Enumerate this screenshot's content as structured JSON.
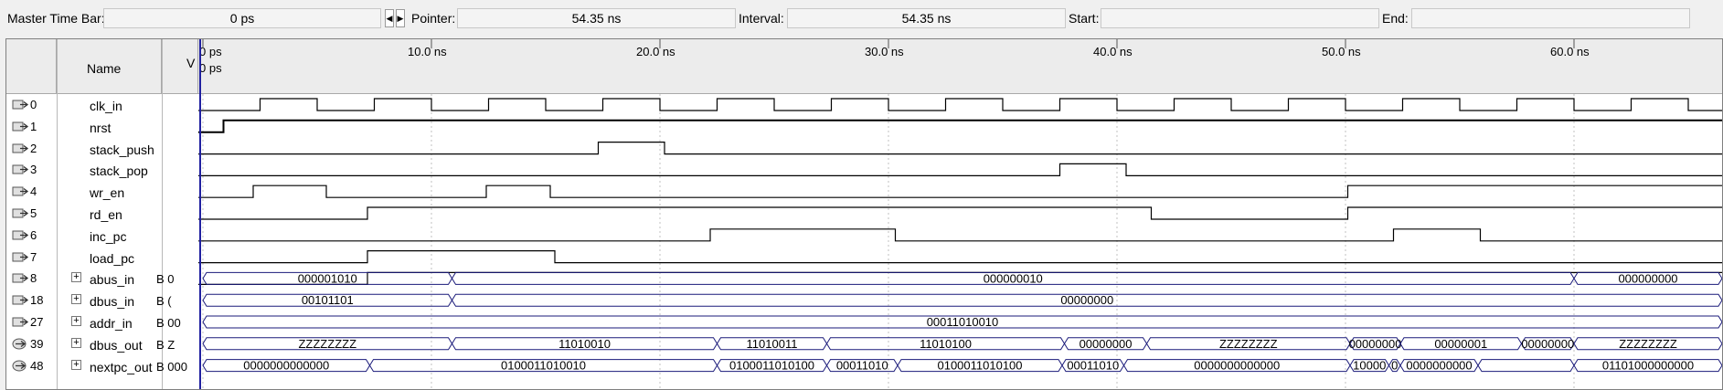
{
  "toolbar": {
    "master_label": "Master Time Bar:",
    "master_value": "0 ps",
    "pointer_label": "Pointer:",
    "pointer_value": "54.35 ns",
    "interval_label": "Interval:",
    "interval_value": "54.35 ns",
    "start_label": "Start:",
    "start_value": "",
    "end_label": "End:",
    "end_value": ""
  },
  "header": {
    "name": "Name",
    "value": "V"
  },
  "ruler": {
    "ticks": [
      "0 ps",
      "10.0 ns",
      "20.0 ns",
      "30.0 ns",
      "40.0 ns",
      "50.0 ns",
      "60.0 ns"
    ],
    "marker_label": "0 ps"
  },
  "signals": [
    {
      "index": "0",
      "name": "clk_in",
      "value": "",
      "kind": "in",
      "bus": false
    },
    {
      "index": "1",
      "name": "nrst",
      "value": "",
      "kind": "in",
      "bus": false
    },
    {
      "index": "2",
      "name": "stack_push",
      "value": "",
      "kind": "in",
      "bus": false
    },
    {
      "index": "3",
      "name": "stack_pop",
      "value": "",
      "kind": "in",
      "bus": false
    },
    {
      "index": "4",
      "name": "wr_en",
      "value": "",
      "kind": "in",
      "bus": false
    },
    {
      "index": "5",
      "name": "rd_en",
      "value": "",
      "kind": "in",
      "bus": false
    },
    {
      "index": "6",
      "name": "inc_pc",
      "value": "",
      "kind": "in",
      "bus": false
    },
    {
      "index": "7",
      "name": "load_pc",
      "value": "",
      "kind": "in",
      "bus": false
    },
    {
      "index": "8",
      "name": "abus_in",
      "value": "B 0",
      "kind": "in",
      "bus": true
    },
    {
      "index": "18",
      "name": "dbus_in",
      "value": "B (",
      "kind": "in",
      "bus": true
    },
    {
      "index": "27",
      "name": "addr_in",
      "value": "B 00",
      "kind": "in",
      "bus": true
    },
    {
      "index": "39",
      "name": "dbus_out",
      "value": "B Z",
      "kind": "out",
      "bus": true
    },
    {
      "index": "48",
      "name": "nextpc_out",
      "value": "B 000",
      "kind": "out",
      "bus": true
    }
  ],
  "waves": {
    "digital": [
      {
        "row": 0,
        "clock": true,
        "period_ns": 5,
        "first_high_ns": 2.5
      },
      {
        "row": 1,
        "init": 0,
        "edges": [
          0.9
        ]
      },
      {
        "row": 2,
        "init": 0,
        "edges": [
          17.3,
          20.2
        ]
      },
      {
        "row": 3,
        "init": 0,
        "edges": [
          37.5,
          40.4
        ]
      },
      {
        "row": 4,
        "init": 0,
        "edges": [
          2.2,
          5.4,
          12.4,
          15.2,
          50.1
        ]
      },
      {
        "row": 5,
        "init": 0,
        "edges": [
          7.2,
          41.5,
          50.1
        ]
      },
      {
        "row": 6,
        "init": 0,
        "edges": [
          22.2,
          30.3,
          52.1,
          55.9
        ]
      },
      {
        "row": 7,
        "init": 0,
        "edges": [
          7.2,
          15.4
        ]
      },
      {
        "row": 8,
        "init": 0,
        "edges": [
          7.2
        ]
      }
    ],
    "buses": [
      {
        "row": 8,
        "segments": [
          {
            "start": 0,
            "end": 10.9,
            "label": "000001010"
          },
          {
            "start": 10.9,
            "end": 60.0,
            "label": "000000010"
          },
          {
            "start": 60.0,
            "end": 67,
            "label": "000000000"
          }
        ]
      },
      {
        "row": 9,
        "segments": [
          {
            "start": 0,
            "end": 10.9,
            "label": "00101101"
          },
          {
            "start": 10.9,
            "end": 67,
            "label": "00000000"
          }
        ]
      },
      {
        "row": 10,
        "segments": [
          {
            "start": 0,
            "end": 67,
            "label": "00011010010"
          }
        ]
      },
      {
        "row": 11,
        "segments": [
          {
            "start": 0,
            "end": 10.9,
            "label": "ZZZZZZZZ"
          },
          {
            "start": 10.9,
            "end": 22.5,
            "label": "11010010"
          },
          {
            "start": 22.5,
            "end": 27.3,
            "label": "11010011"
          },
          {
            "start": 27.3,
            "end": 37.7,
            "label": "11010100"
          },
          {
            "start": 37.7,
            "end": 41.3,
            "label": "00000000"
          },
          {
            "start": 41.3,
            "end": 50.2,
            "label": "ZZZZZZZZ"
          },
          {
            "start": 50.2,
            "end": 52.4,
            "label": "00000000"
          },
          {
            "start": 52.4,
            "end": 57.7,
            "label": "00000001"
          },
          {
            "start": 57.7,
            "end": 60.0,
            "label": "00000000"
          },
          {
            "start": 60.0,
            "end": 67,
            "label": "ZZZZZZZZ"
          }
        ]
      },
      {
        "row": 12,
        "segments": [
          {
            "start": 0,
            "end": 7.3,
            "label": "0000000000000"
          },
          {
            "start": 7.3,
            "end": 22.5,
            "label": "0100011010010"
          },
          {
            "start": 22.5,
            "end": 27.3,
            "label": "0100011010100"
          },
          {
            "start": 27.3,
            "end": 30.4,
            "label": "00011010"
          },
          {
            "start": 30.4,
            "end": 37.6,
            "label": "0100011010100"
          },
          {
            "start": 37.6,
            "end": 40.3,
            "label": "00011010"
          },
          {
            "start": 40.3,
            "end": 50.2,
            "label": "0000000000000"
          },
          {
            "start": 50.2,
            "end": 51.9,
            "label": "10000"
          },
          {
            "start": 51.9,
            "end": 52.4,
            "label": "0"
          },
          {
            "start": 52.4,
            "end": 55.8,
            "label": "0000000000"
          },
          {
            "start": 55.8,
            "end": 60.0,
            "label": ""
          },
          {
            "start": 60.0,
            "end": 67,
            "label": "01101000000000"
          }
        ]
      }
    ]
  },
  "colors": {
    "wave": "#000000",
    "bus": "#1a1a7a",
    "cursor": "#2020a0",
    "grid": "#c0c0c0"
  }
}
